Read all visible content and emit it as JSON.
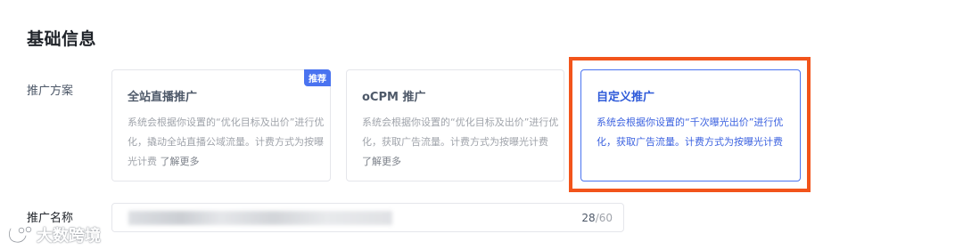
{
  "section": {
    "title": "基础信息"
  },
  "plan": {
    "label": "推广方案",
    "cards": [
      {
        "title": "全站直播推广",
        "badge": "推荐",
        "desc": "系统会根据你设置的“优化目标及出价”进行优化，撬动全站直播公域流量。计费方式为按曝光计费",
        "link": "了解更多",
        "selected": false
      },
      {
        "title": "oCPM 推广",
        "desc": "系统会根据你设置的“优化目标及出价”进行优化，获取广告流量。计费方式为按曝光计费",
        "link": "了解更多",
        "selected": false
      },
      {
        "title": "自定义推广",
        "desc": "系统会根据你设置的“千次曝光出价”进行优化，获取广告流量。计费方式为按曝光计费",
        "selected": true
      }
    ]
  },
  "name": {
    "label": "推广名称",
    "count": "28",
    "max": "/60"
  },
  "watermark": {
    "text": "大数跨境"
  },
  "colors": {
    "accent": "#4a73f0",
    "highlight": "#f2541b"
  }
}
